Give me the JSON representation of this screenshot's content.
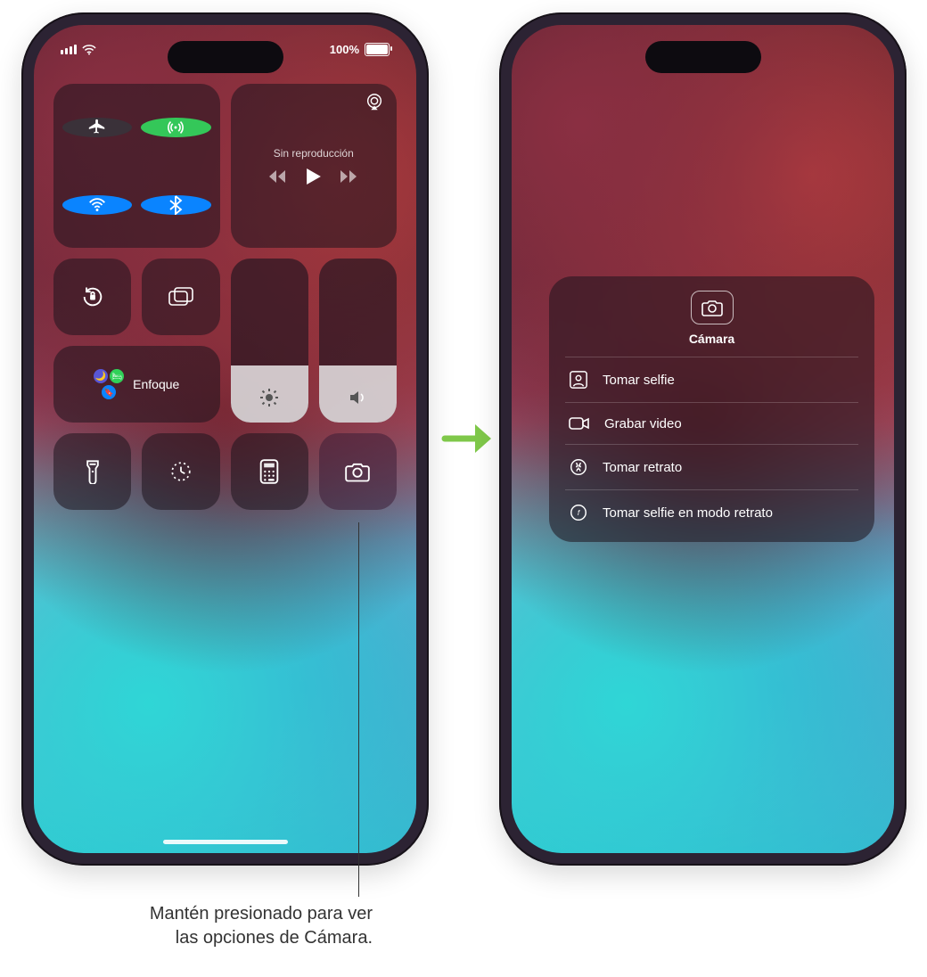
{
  "status": {
    "battery_pct": "100%"
  },
  "left": {
    "media": {
      "label": "Sin reproducción"
    },
    "focus": {
      "label": "Enfoque"
    }
  },
  "right": {
    "camera_popup": {
      "title": "Cámara",
      "items": [
        {
          "label": "Tomar selfie"
        },
        {
          "label": "Grabar video"
        },
        {
          "label": "Tomar retrato"
        },
        {
          "label": "Tomar selfie en modo retrato"
        }
      ]
    }
  },
  "callout": {
    "text_line1": "Mantén presionado para ver",
    "text_line2": "las opciones de Cámara."
  },
  "colors": {
    "airplane_off": "#3a3139",
    "cellular_on": "#34c759",
    "wifi_on": "#0a84ff",
    "bluetooth_on": "#0a84ff",
    "arrow": "#7fc84a"
  }
}
